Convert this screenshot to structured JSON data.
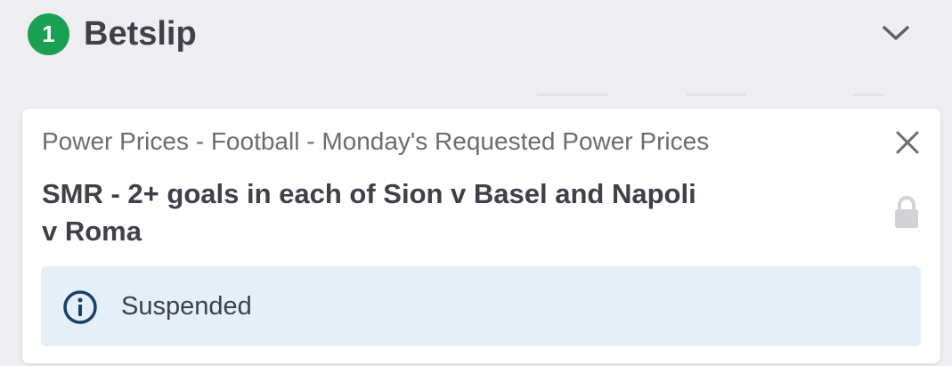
{
  "betslip": {
    "count": "1",
    "title": "Betslip"
  },
  "selection": {
    "market": "Power Prices - Football - Monday's Requested Power Prices",
    "name": "SMR - 2+ goals in each of Sion v Basel and Napoli v Roma",
    "status": "Suspended"
  },
  "icons": {
    "collapse": "chevron-down-icon",
    "close": "close-icon",
    "lock": "lock-icon",
    "info": "info-icon"
  },
  "colors": {
    "badge": "#1aa052",
    "status_bg": "#e4eff8",
    "info": "#17406a",
    "text": "#3f4049",
    "muted_text": "#6b6c74"
  }
}
